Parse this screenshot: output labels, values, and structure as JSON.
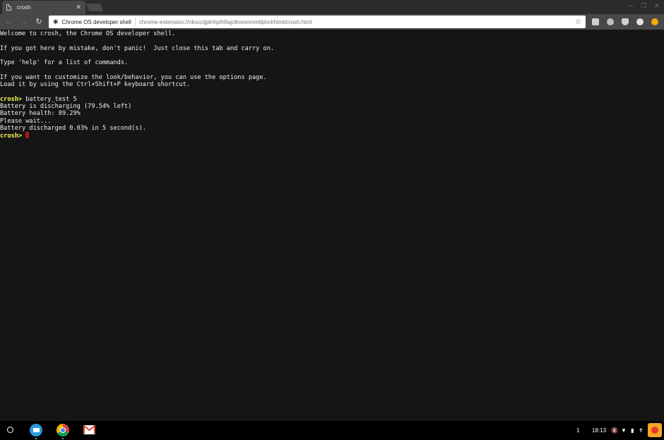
{
  "browser": {
    "tab_title": "crosh",
    "tab_close": "✕",
    "window_buttons": [
      "—",
      "❐",
      "✕"
    ],
    "site_name": "Chrome OS developer shell",
    "url": "chrome-extension://nkoccljplnhpfnfiajclkommnmllphnl/html/crosh.html",
    "nav": {
      "back": "←",
      "forward": "→",
      "reload": "↻"
    },
    "extension_icons": [
      {
        "icon": "chat-bubble-icon",
        "color": "#cfcfcf"
      },
      {
        "icon": "reader-icon",
        "color": "#cfcfcf"
      },
      {
        "icon": "shield-icon",
        "color": "#cfcfcf"
      },
      {
        "icon": "hangouts-icon",
        "color": "#cfcfcf"
      },
      {
        "icon": "warning-icon",
        "color": "#f4a90b"
      }
    ]
  },
  "terminal": {
    "prompt": "crosh>",
    "lines": [
      {
        "text": "Welcome to crosh, the Chrome OS developer shell."
      },
      {
        "text": ""
      },
      {
        "text": "If you got here by mistake, don't panic!  Just close this tab and carry on."
      },
      {
        "text": ""
      },
      {
        "text": "Type 'help' for a list of commands."
      },
      {
        "text": ""
      },
      {
        "text": "If you want to customize the look/behavior, you can use the options page."
      },
      {
        "text": "Load it by using the Ctrl+Shift+P keyboard shortcut."
      },
      {
        "text": ""
      },
      {
        "prompt": true,
        "text": " battery_test 5"
      },
      {
        "text": "Battery is discharging (79.54% left)"
      },
      {
        "text": "Battery health: 89.29%"
      },
      {
        "text": "Please wait..."
      },
      {
        "text": "Battery discharged 0.03% in 5 second(s)."
      },
      {
        "prompt": true,
        "text": " ",
        "cursor": true
      }
    ],
    "colors": {
      "prompt": "#ffff55",
      "cursor": "#b01616",
      "text": "#f0f0f0",
      "background": "#151515"
    }
  },
  "shelf": {
    "apps": [
      "files-app-icon",
      "chrome-app-icon",
      "gmail-app-icon"
    ],
    "notification_count": "1",
    "time": "18:13"
  }
}
